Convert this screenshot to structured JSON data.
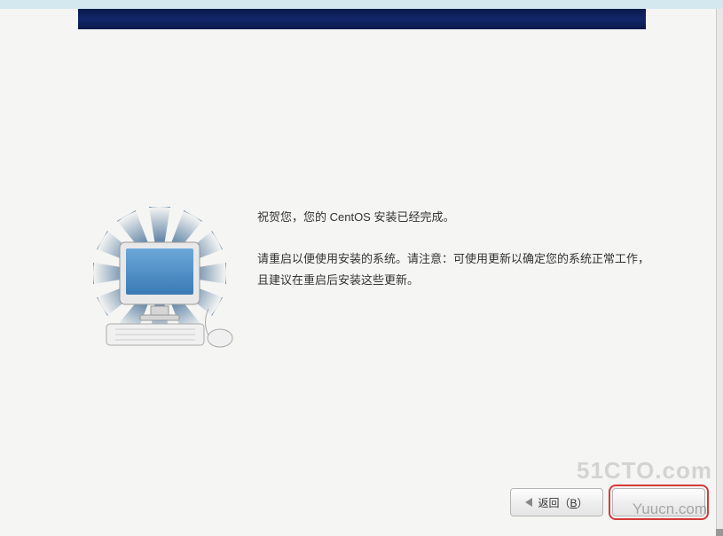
{
  "header": {
    "banner_color": "#13266a"
  },
  "messages": {
    "congrats": "祝贺您，您的 CentOS 安装已经完成。",
    "instructions": "请重启以便使用安装的系统。请注意：可使用更新以确定您的系统正常工作，且建议在重启后安装这些更新。"
  },
  "buttons": {
    "back_label": "返回（",
    "back_key": "B",
    "back_label_end": "）"
  },
  "watermarks": {
    "w1": "51CTO.com",
    "w2": "Yuucn.com"
  }
}
